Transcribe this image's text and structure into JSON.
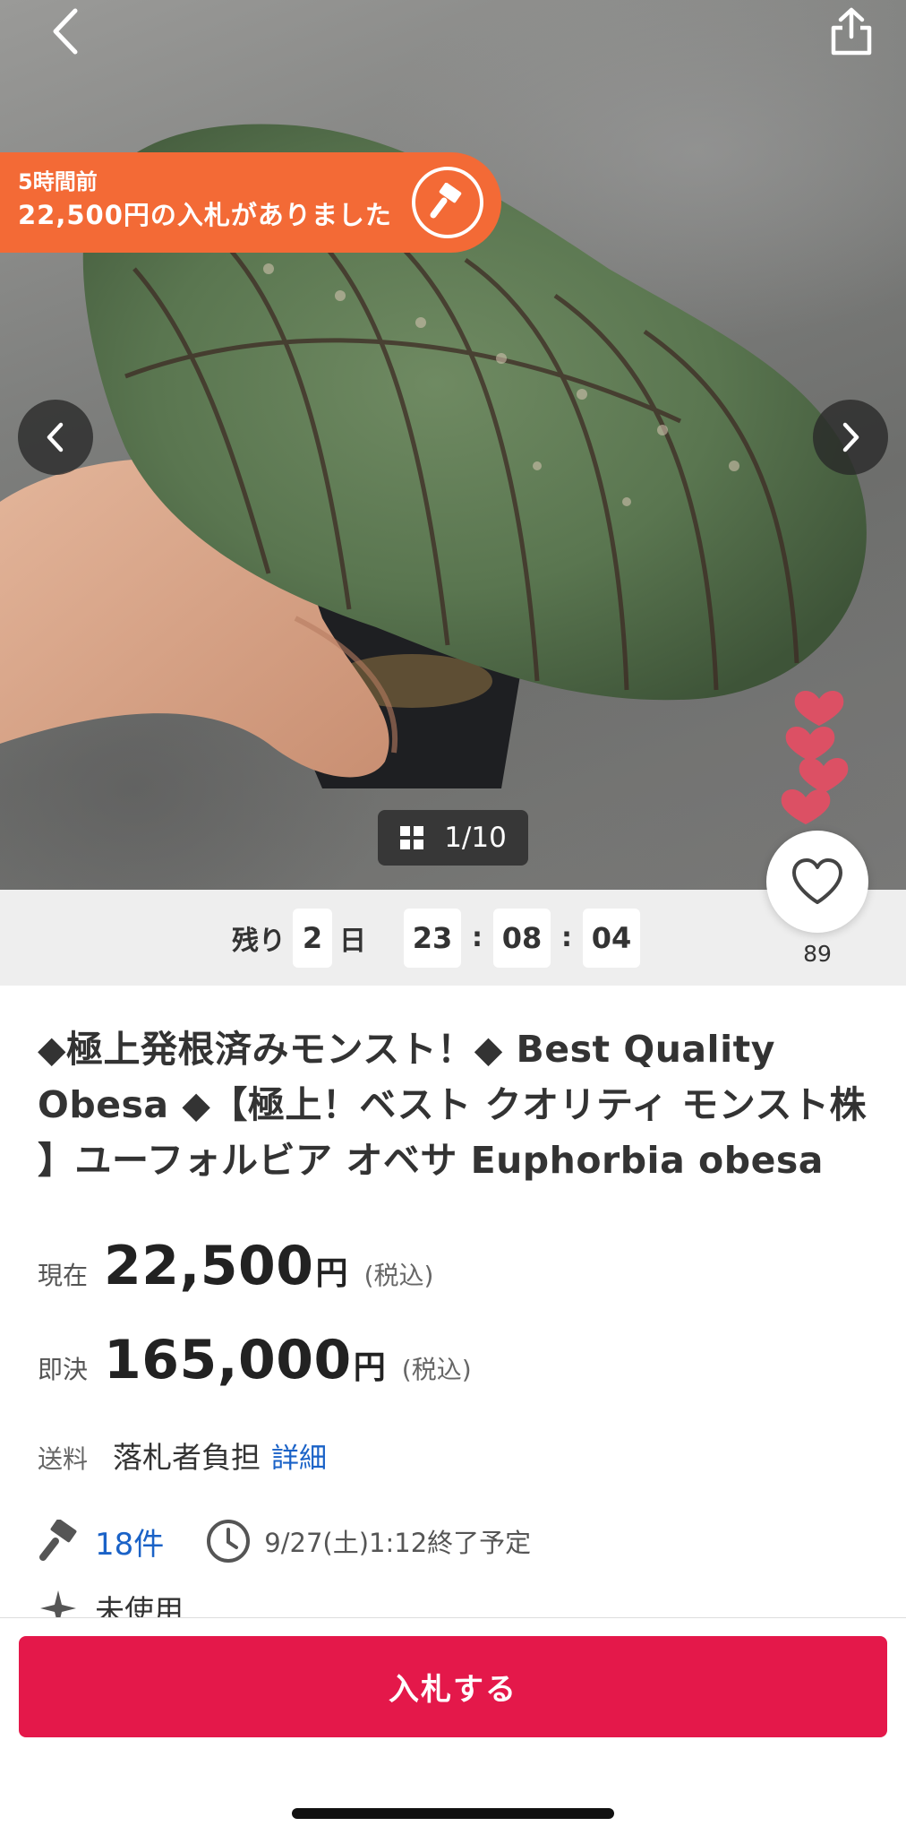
{
  "header": {
    "back_icon": "chevron-left-icon",
    "share_icon": "share-icon"
  },
  "bid_notice": {
    "time_ago": "5時間前",
    "message": "22,500円の入札がありました",
    "icon": "gavel-icon",
    "color": "#f36a36"
  },
  "gallery": {
    "counter": "1/10",
    "prev_icon": "chevron-left-icon",
    "next_icon": "chevron-right-icon"
  },
  "countdown": {
    "prefix": "残り",
    "days": "2",
    "days_unit": "日",
    "hours": "23",
    "minutes": "08",
    "seconds": "04",
    "separator": ":"
  },
  "favorite": {
    "count": "89",
    "icon": "heart-icon"
  },
  "product": {
    "title": "◆極上発根済みモンスト！◆ Best Quality Obesa ◆【極上！ベスト クオリティ モンスト株 】ユーフォルビア オベサ Euphorbia obesa"
  },
  "price": {
    "current_label": "現在",
    "current_value": "22,500",
    "buynow_label": "即決",
    "buynow_value": "165,000",
    "currency": "円",
    "tax_note": "(税込)"
  },
  "shipping": {
    "label": "送料",
    "value": "落札者負担",
    "detail_link": "詳細"
  },
  "meta": {
    "bid_count": "18件",
    "end_time": "9/27(土)1:12終了予定"
  },
  "condition": {
    "value": "未使用"
  },
  "actions": {
    "bid_button": "入札する",
    "accent_color": "#e4184a",
    "link_color": "#1a62c7"
  }
}
